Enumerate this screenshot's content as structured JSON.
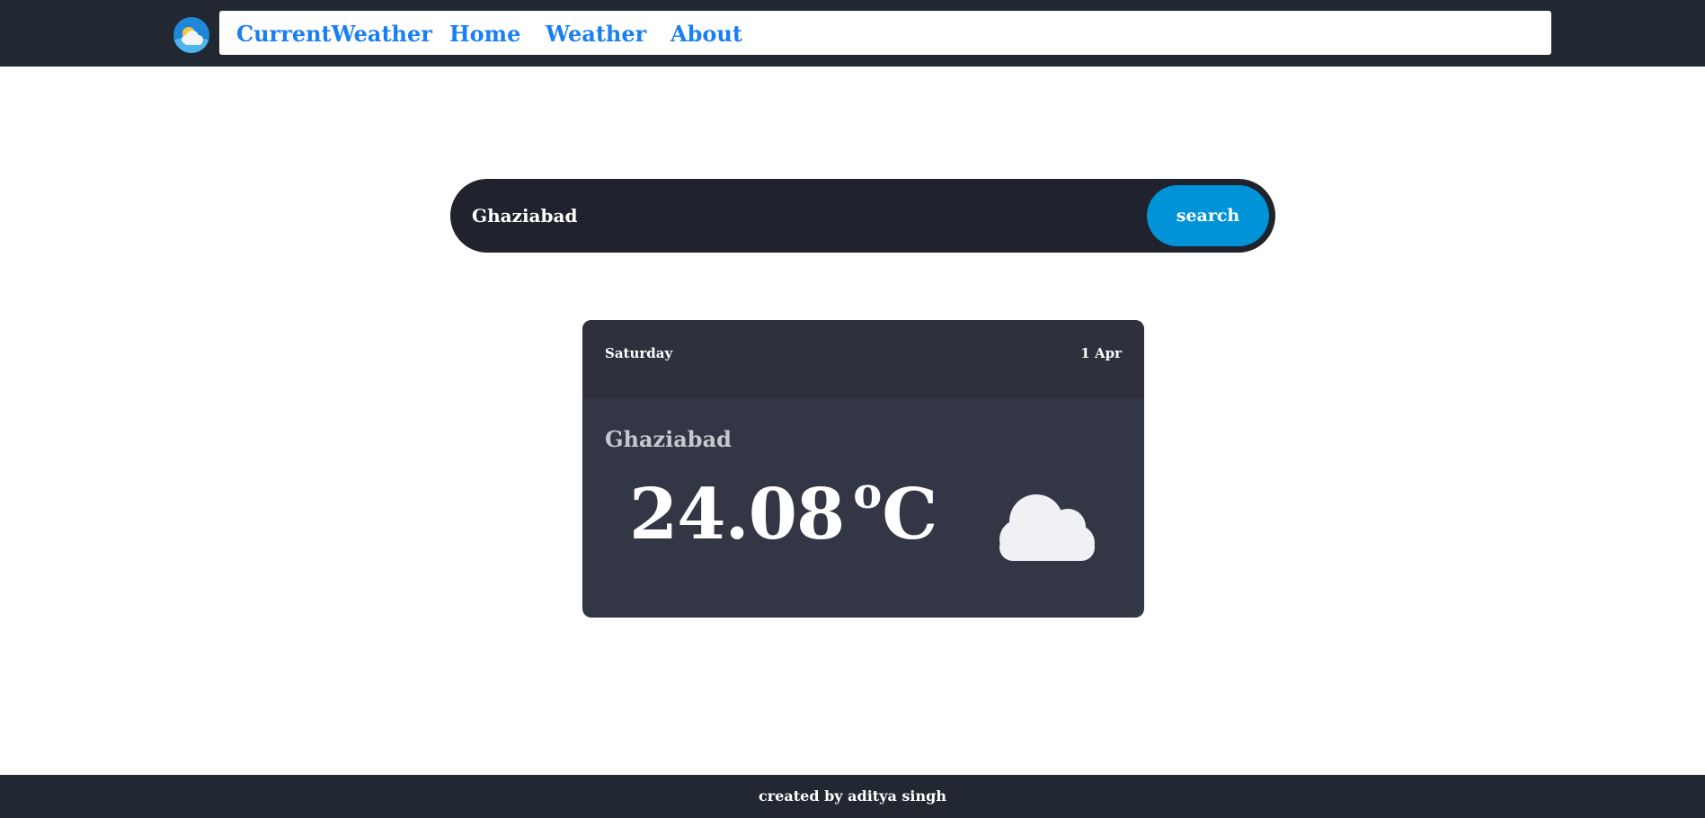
{
  "navbar": {
    "logo_icon": "cloud-sun-icon",
    "brand": "CurrentWeather",
    "links": [
      "Home",
      "Weather",
      "About"
    ],
    "link_color": "#1a7ff0",
    "background": "#212831"
  },
  "search": {
    "value": "Ghaziabad",
    "button_label": "search",
    "button_color": "#0093d8"
  },
  "weather_card": {
    "day": "Saturday",
    "date": "1 Apr",
    "city": "Ghaziabad",
    "temperature": "24.08",
    "degree_symbol": "o",
    "unit": "C",
    "condition_icon": "cloud-icon"
  },
  "footer": {
    "text": "created by aditya singh"
  }
}
